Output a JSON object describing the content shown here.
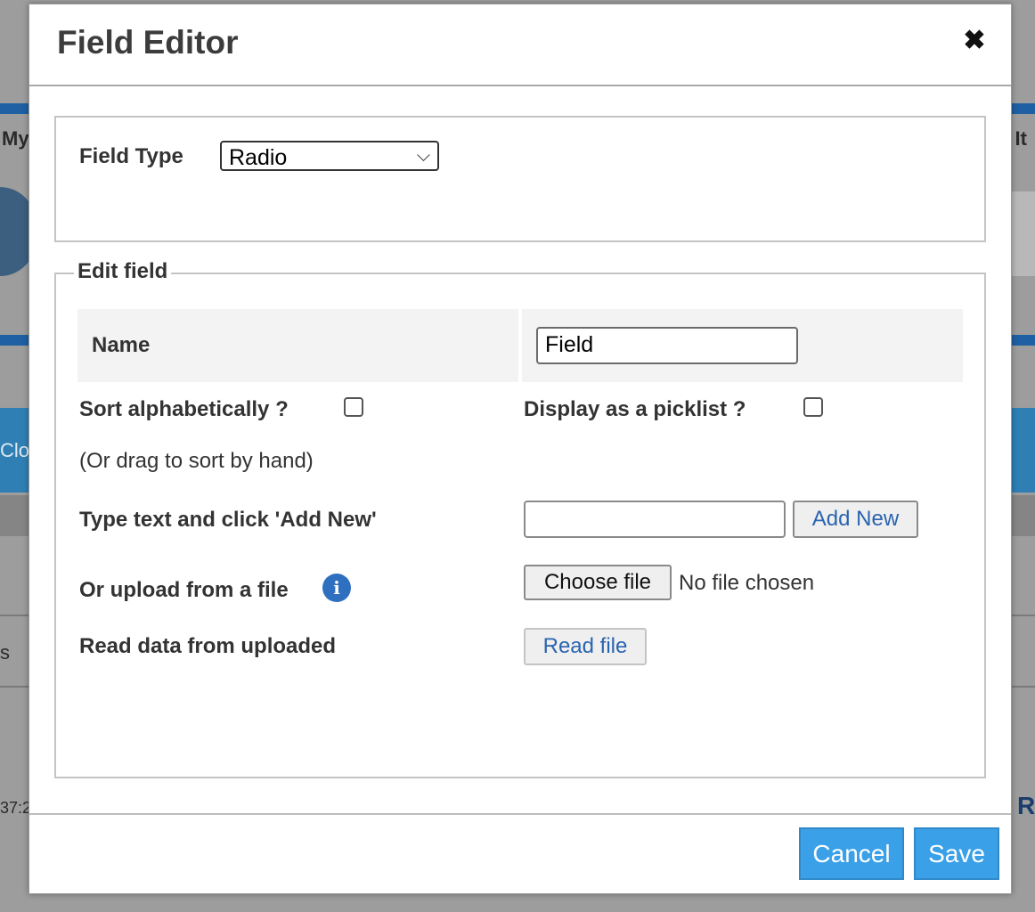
{
  "background": {
    "left_fragment_1": "My",
    "left_fragment_2": "Clo",
    "left_fragment_3": "s",
    "left_fragment_4": "37:2",
    "right_fragment_1": "d It",
    "right_fragment_2": "R"
  },
  "modal": {
    "title": "Field Editor",
    "close_icon": "close-icon",
    "field_type_label": "Field Type",
    "field_type_value": "Radio",
    "edit_field_legend": "Edit field",
    "name_label": "Name",
    "name_value": "Field",
    "sort_label": "Sort alphabetically ?",
    "sort_checked": false,
    "picklist_label": "Display as a picklist ?",
    "picklist_checked": false,
    "drag_hint": "(Or drag to sort by hand)",
    "add_new_prompt": "Type text and click 'Add New'",
    "add_new_value": "",
    "add_new_button": "Add New",
    "upload_label": "Or upload from a file",
    "info_icon": "info-icon",
    "choose_file_button": "Choose file",
    "no_file_text": "No file chosen",
    "read_data_label": "Read data from uploaded",
    "read_file_button": "Read file",
    "cancel_button": "Cancel",
    "save_button": "Save"
  },
  "colors": {
    "primary_button": "#3aa0e8",
    "link_blue": "#2a64b0",
    "info_icon": "#2f6fbf"
  }
}
